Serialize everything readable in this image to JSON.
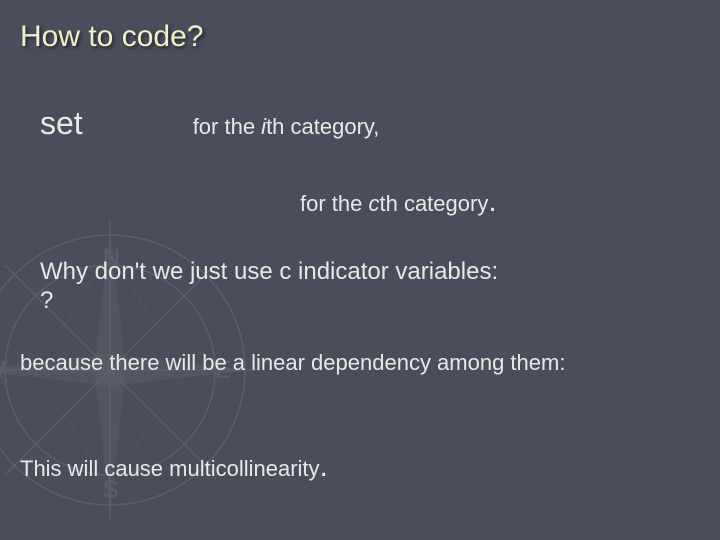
{
  "title": "How to code?",
  "set_label": "set",
  "ith": {
    "prefix": "for the ",
    "var": "i",
    "suffix": "th category,"
  },
  "cth": {
    "prefix": "for the ",
    "var": "c",
    "suffix": "th category",
    "period": "."
  },
  "why_line1": "Why don't we just use c indicator variables:",
  "why_line2": "?",
  "because": "because there will be a linear dependency among them:",
  "multi_text": "This will cause multicollinearity",
  "multi_period": "."
}
